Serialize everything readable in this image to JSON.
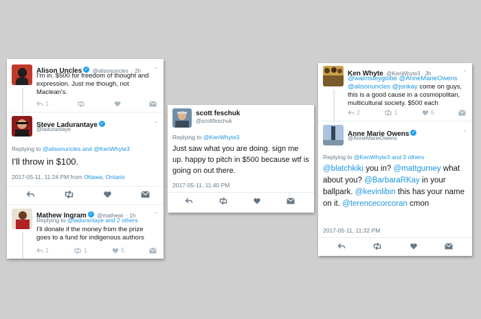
{
  "card1": {
    "tweet1": {
      "name": "Alison Uncles",
      "handle": "@alisonuncles",
      "time": "· 2h",
      "text": "I'm in. $500 for freedom of thought and expression. Just me though, not Maclean's.",
      "reply_count": "1"
    },
    "tweet2": {
      "name": "Steve Ladurantaye",
      "handle": "@ladurantaye",
      "replying_prefix": "Replying to",
      "replying_a": "@alisonuncles",
      "replying_and": "and",
      "replying_b": "@KenWhyte3",
      "text": "I'll throw in $100.",
      "timestamp": "2017-05-11, 11:24 PM from",
      "place_a": "Ottawa",
      "place_sep": ",",
      "place_b": "Ontario"
    },
    "tweet3": {
      "name": "Mathew Ingram",
      "handle": "@mathewi",
      "time": "· 1h",
      "replying_prefix": "Replying to",
      "replying_a": "@ladurantaye",
      "replying_rest": "and 2 others",
      "text": "I'll donate if the money from the prize goes to a fund for indigenous authors",
      "reply_count": "1",
      "retweet_count": "1",
      "like_count": "5"
    }
  },
  "card2": {
    "name": "scott feschuk",
    "handle": "@scottfeschuk",
    "replying_prefix": "Replying to",
    "replying_a": "@KenWhyte3",
    "text": "Just saw what you are doing. sign me up. happy to pitch in $500 because wtf is going on out there.",
    "timestamp": "2017-05-11, 11:40 PM"
  },
  "card3": {
    "tweet1": {
      "name": "Ken Whyte",
      "handle": "@KenWhyte3 · 3h",
      "mention1": "@walmsleyglobe",
      "mention2": "@AnneMarieOwens",
      "mention3": "@alisonuncles",
      "mention4": "@jonkay",
      "text": "come on guys, this is a good cause in a cosmopolitan, multicultural society. $500 each",
      "reply_count": "2",
      "retweet_count": "1",
      "like_count": "6"
    },
    "tweet2": {
      "name": "Anne Marie Owens",
      "handle": "@AnneMarieOwens",
      "replying_prefix": "Replying to",
      "replying_a": "@KenWhyte3",
      "replying_rest": "and 3 others",
      "m1": "@blatchkiki",
      "t1": "you in?",
      "m2": "@mattgurney",
      "t2": "what about you?",
      "m3": "@BarbaraRKay",
      "t3": "in your ballpark.",
      "m4": "@kevinlibin",
      "t4": "this has your name on it.",
      "m5": "@terencecorcoran",
      "t5": "cmon",
      "timestamp": "2017-05-11, 11:32 PM"
    }
  },
  "colors": {
    "link": "#1b95e0",
    "verified": "#1da1f2",
    "background": "#cfcfcf"
  }
}
